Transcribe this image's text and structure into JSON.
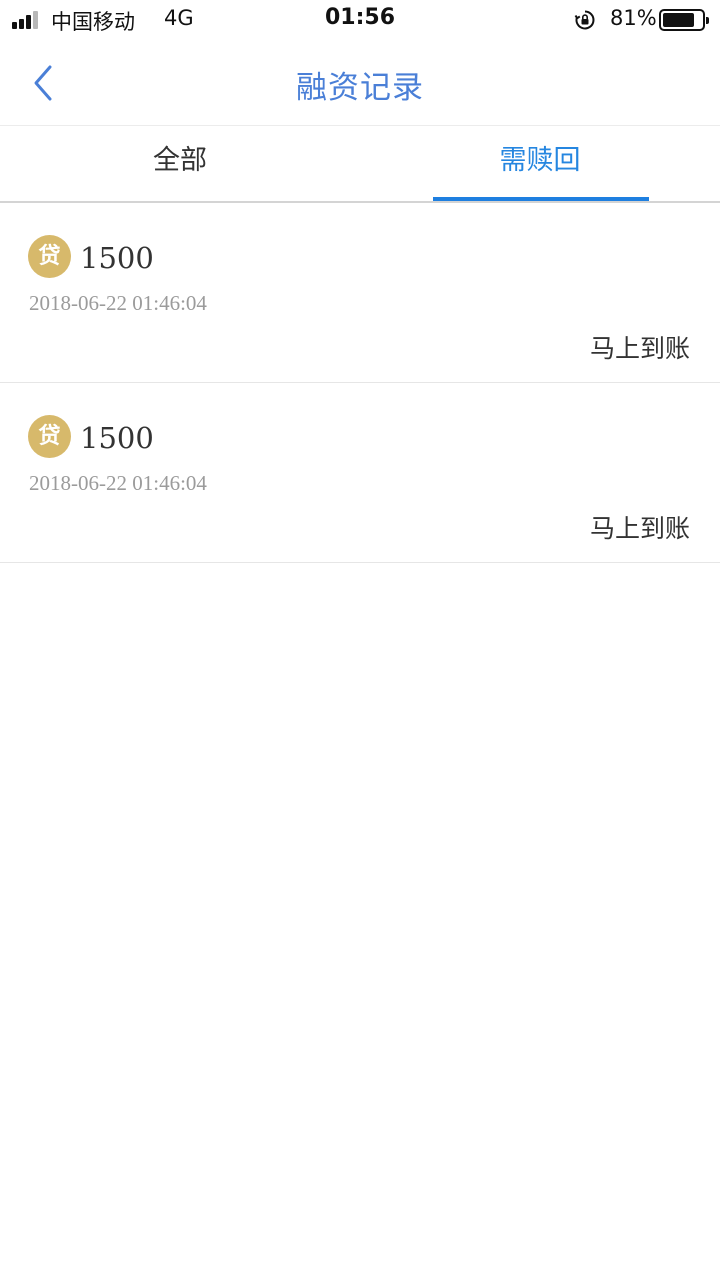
{
  "status_bar": {
    "carrier": "中国移动",
    "network": "4G",
    "time": "01:56",
    "battery_percent": "81%",
    "battery_level": 0.81,
    "signal_bars_active": 3,
    "signal_bars_total": 4
  },
  "nav": {
    "title": "融资记录",
    "back_icon": "chevron-left-icon",
    "accent_color": "#4a7fd7"
  },
  "tabs": [
    {
      "label": "全部",
      "selected": false
    },
    {
      "label": "需赎回",
      "selected": true
    }
  ],
  "tab_active_color": "#1e7fe0",
  "records": [
    {
      "badge": "贷",
      "amount": "1500",
      "timestamp": "2018-06-22 01:46:04",
      "status": "马上到账"
    },
    {
      "badge": "贷",
      "amount": "1500",
      "timestamp": "2018-06-22 01:46:04",
      "status": "马上到账"
    }
  ],
  "badge_color": "#d7b96b"
}
